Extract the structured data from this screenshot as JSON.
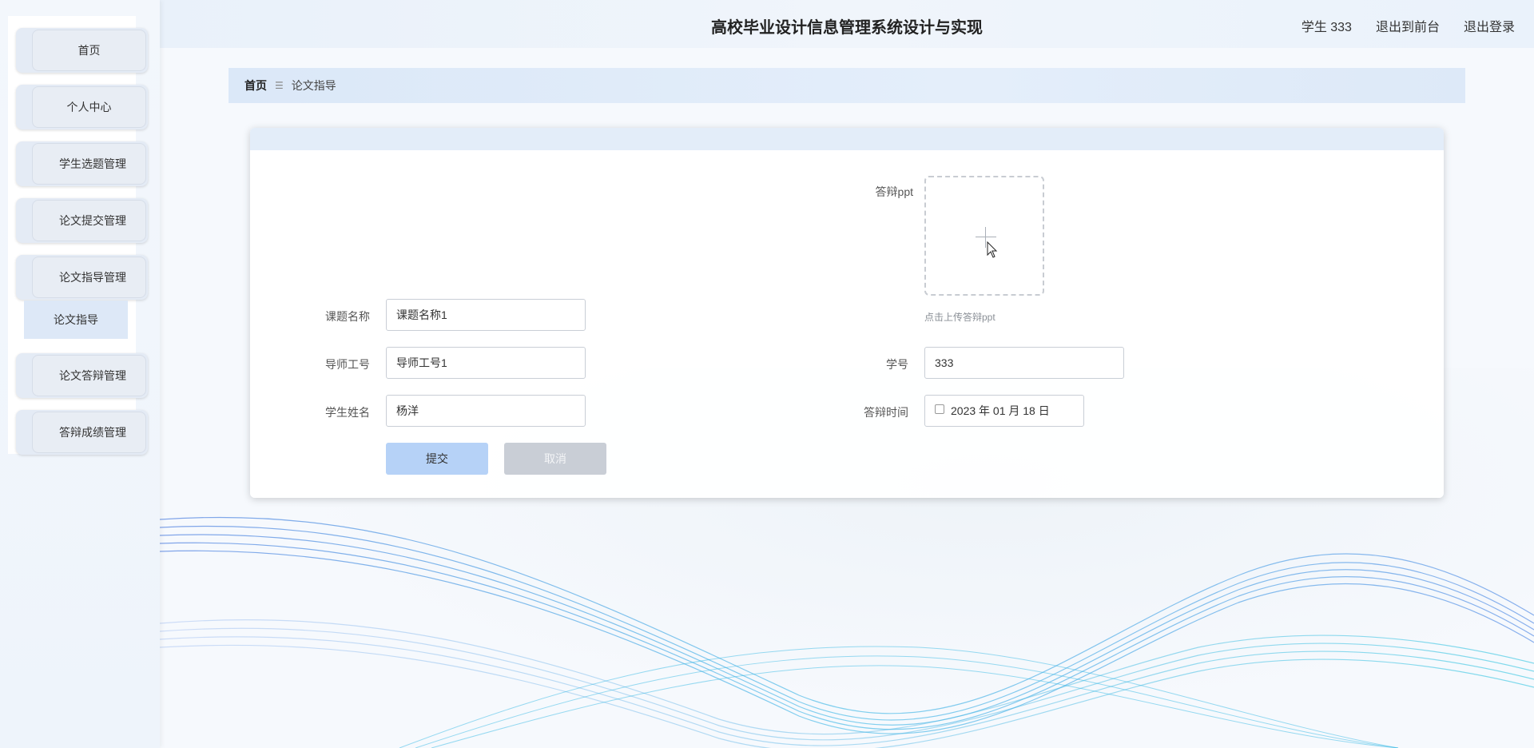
{
  "header": {
    "app_title": "高校毕业设计信息管理系统设计与实现",
    "user_label": "学生 333",
    "back_to_front": "退出到前台",
    "logout": "退出登录"
  },
  "sidebar": {
    "items": [
      {
        "label": "首页"
      },
      {
        "label": "个人中心"
      },
      {
        "label": "学生选题管理"
      },
      {
        "label": "论文提交管理"
      },
      {
        "label": "论文指导管理"
      },
      {
        "label": "论文答辩管理"
      },
      {
        "label": "答辩成绩管理"
      }
    ],
    "submenu": {
      "label": "论文指导"
    }
  },
  "breadcrumb": {
    "home": "首页",
    "separator": "☰",
    "current": "论文指导"
  },
  "form": {
    "upload": {
      "label": "答辩ppt",
      "tip": "点击上传答辩ppt"
    },
    "topic_name": {
      "label": "课题名称",
      "value": "课题名称1"
    },
    "teacher_id": {
      "label": "导师工号",
      "value": "导师工号1"
    },
    "student_id": {
      "label": "学号",
      "value": "333"
    },
    "student_name": {
      "label": "学生姓名",
      "value": "杨洋"
    },
    "defense_time": {
      "label": "答辩时间",
      "value": "2023 年 01 月 18 日"
    },
    "submit_label": "提交",
    "cancel_label": "取消"
  },
  "colors": {
    "accent": "#b6d2f7",
    "breadcrumb_bg": "#dbe8f8",
    "card_head": "#e3edf9",
    "wave_blue": "#5b8fe0",
    "wave_cyan": "#2ec0e0"
  }
}
